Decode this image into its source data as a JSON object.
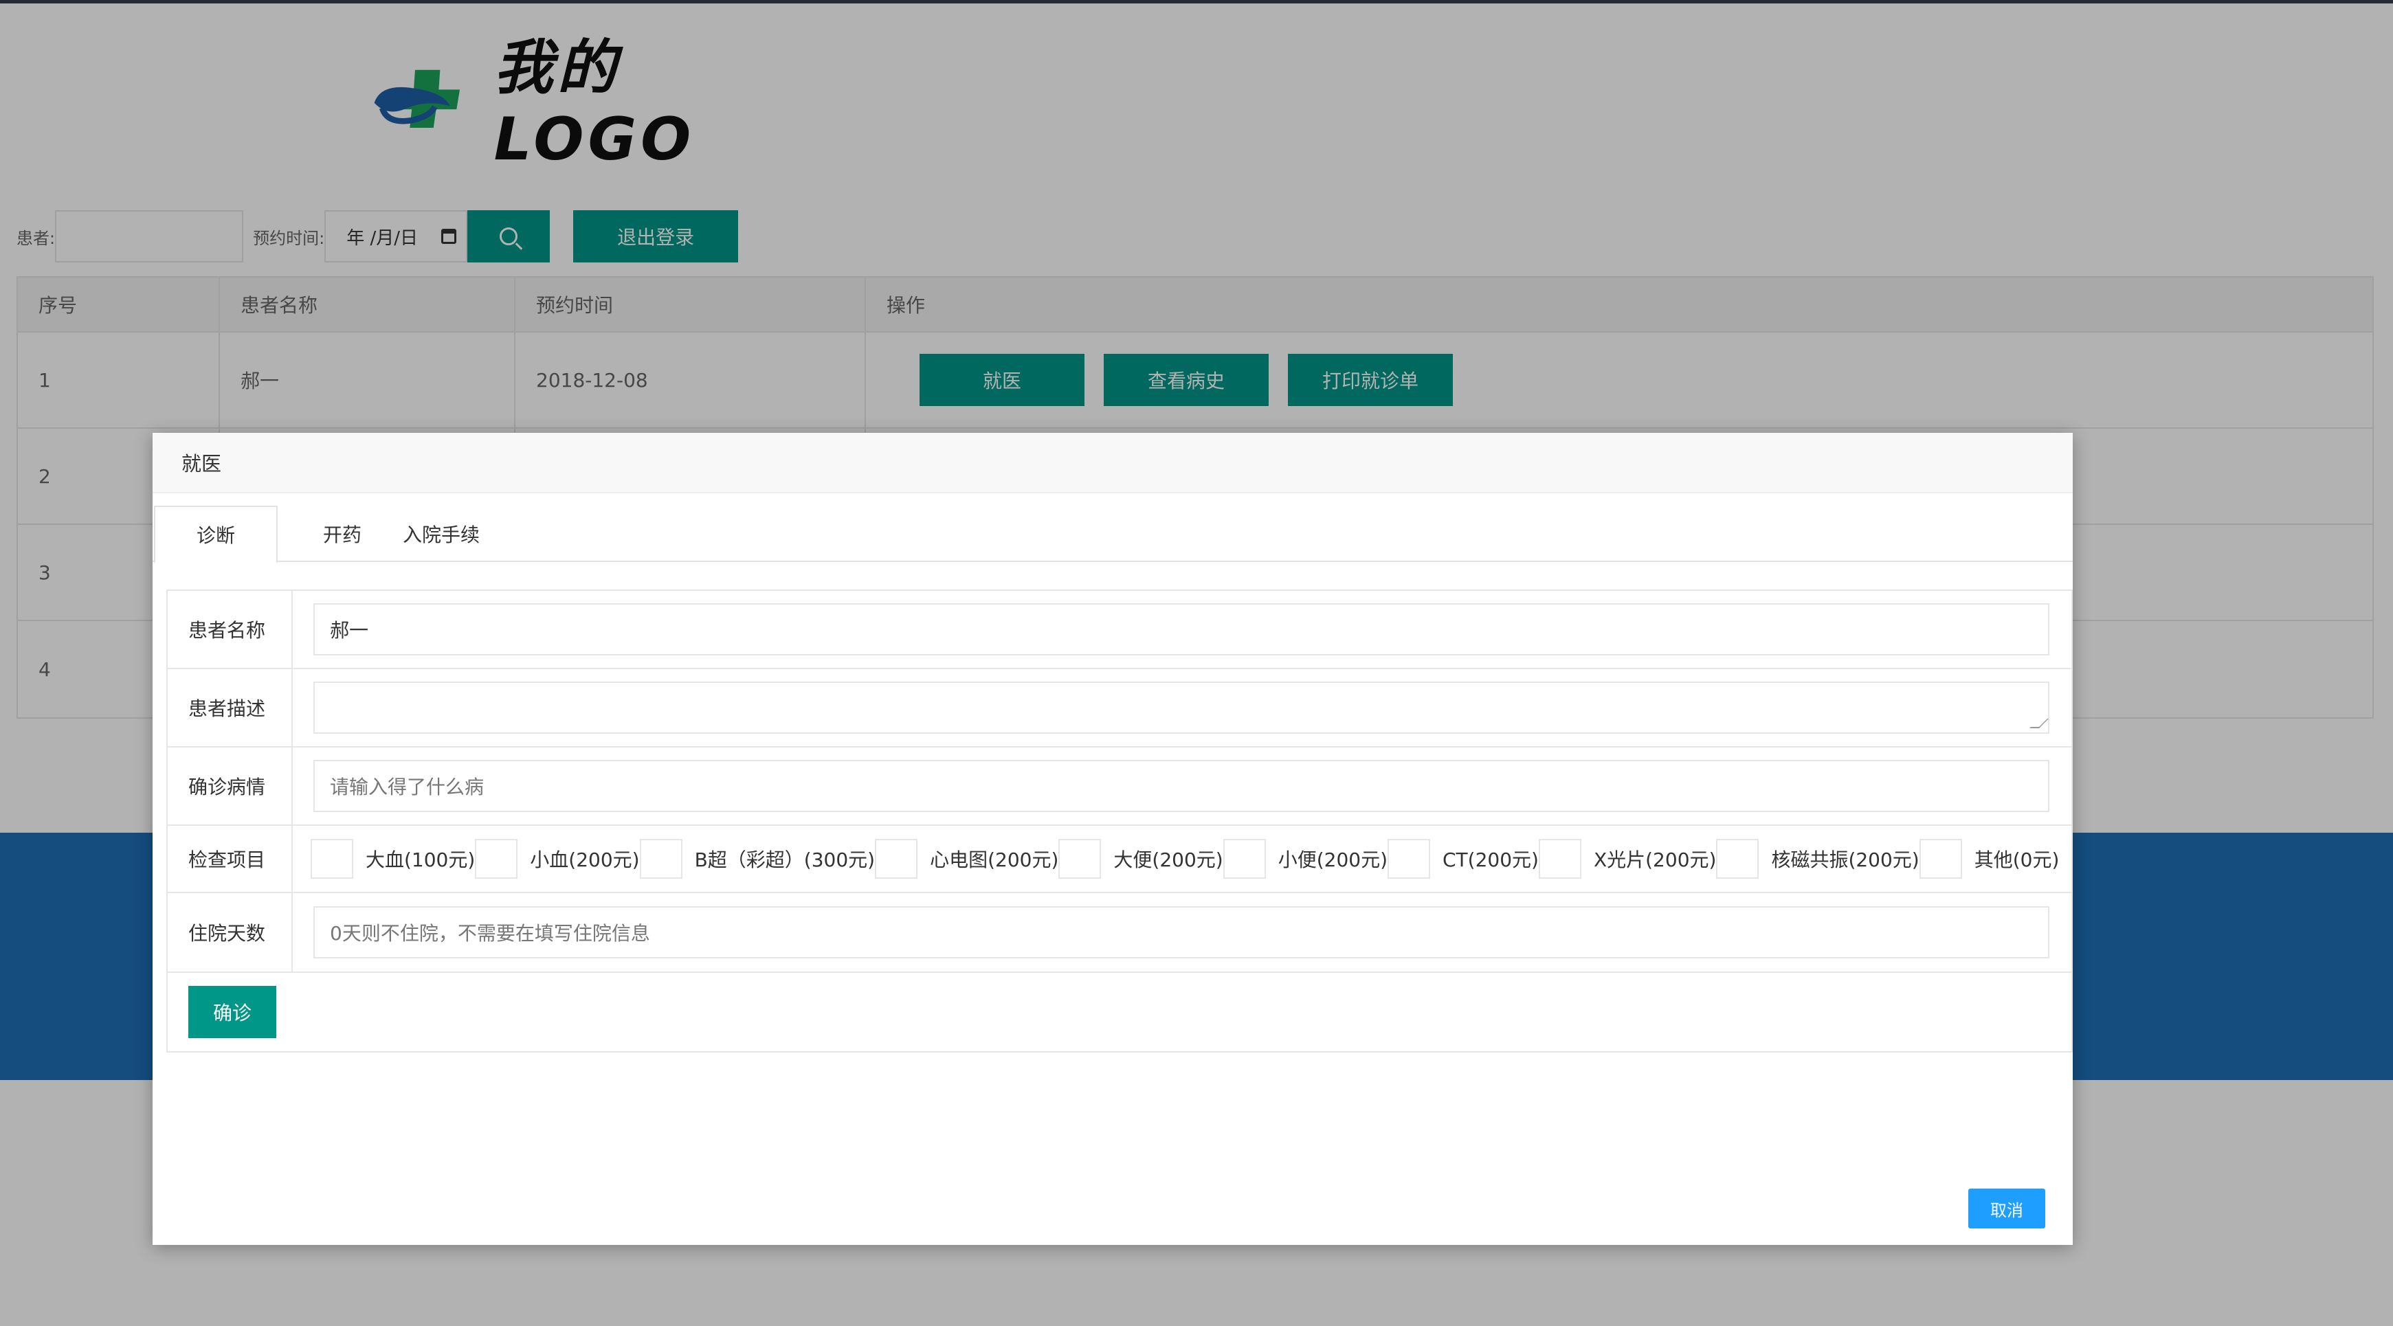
{
  "logo": {
    "text": "我的LOGO"
  },
  "search": {
    "patient_label": "患者:",
    "date_label": "预约时间:",
    "date_value": "年 /月/日",
    "logout_label": "退出登录"
  },
  "table": {
    "headers": [
      "序号",
      "患者名称",
      "预约时间",
      "操作"
    ],
    "rows": [
      {
        "index": "1",
        "name": "郝一",
        "date": "2018-12-08"
      },
      {
        "index": "2",
        "name": "",
        "date": ""
      },
      {
        "index": "3",
        "name": "",
        "date": ""
      },
      {
        "index": "4",
        "name": "",
        "date": ""
      }
    ],
    "actions": [
      "就医",
      "查看病史",
      "打印就诊单"
    ]
  },
  "modal": {
    "title": "就医",
    "tabs": [
      "诊断",
      "开药",
      "入院手续"
    ],
    "form": {
      "name_label": "患者名称",
      "name_value": "郝一",
      "desc_label": "患者描述",
      "desc_value": "",
      "diagnosis_label": "确诊病情",
      "diagnosis_placeholder": "请输入得了什么病",
      "exam_label": "检查项目",
      "exams": [
        "大血(100元)",
        "小血(200元)",
        "B超（彩超）(300元)",
        "心电图(200元)",
        "大便(200元)",
        "小便(200元)",
        "CT(200元)",
        "X光片(200元)",
        "核磁共振(200元)",
        "其他(0元)"
      ],
      "days_label": "住院天数",
      "days_placeholder": "0天则不住院，不需要在填写住院信息",
      "confirm_label": "确诊"
    },
    "cancel_label": "取消"
  },
  "colors": {
    "primary": "#009688",
    "cancel": "#1e9fff",
    "band": "#1e6fb5"
  }
}
